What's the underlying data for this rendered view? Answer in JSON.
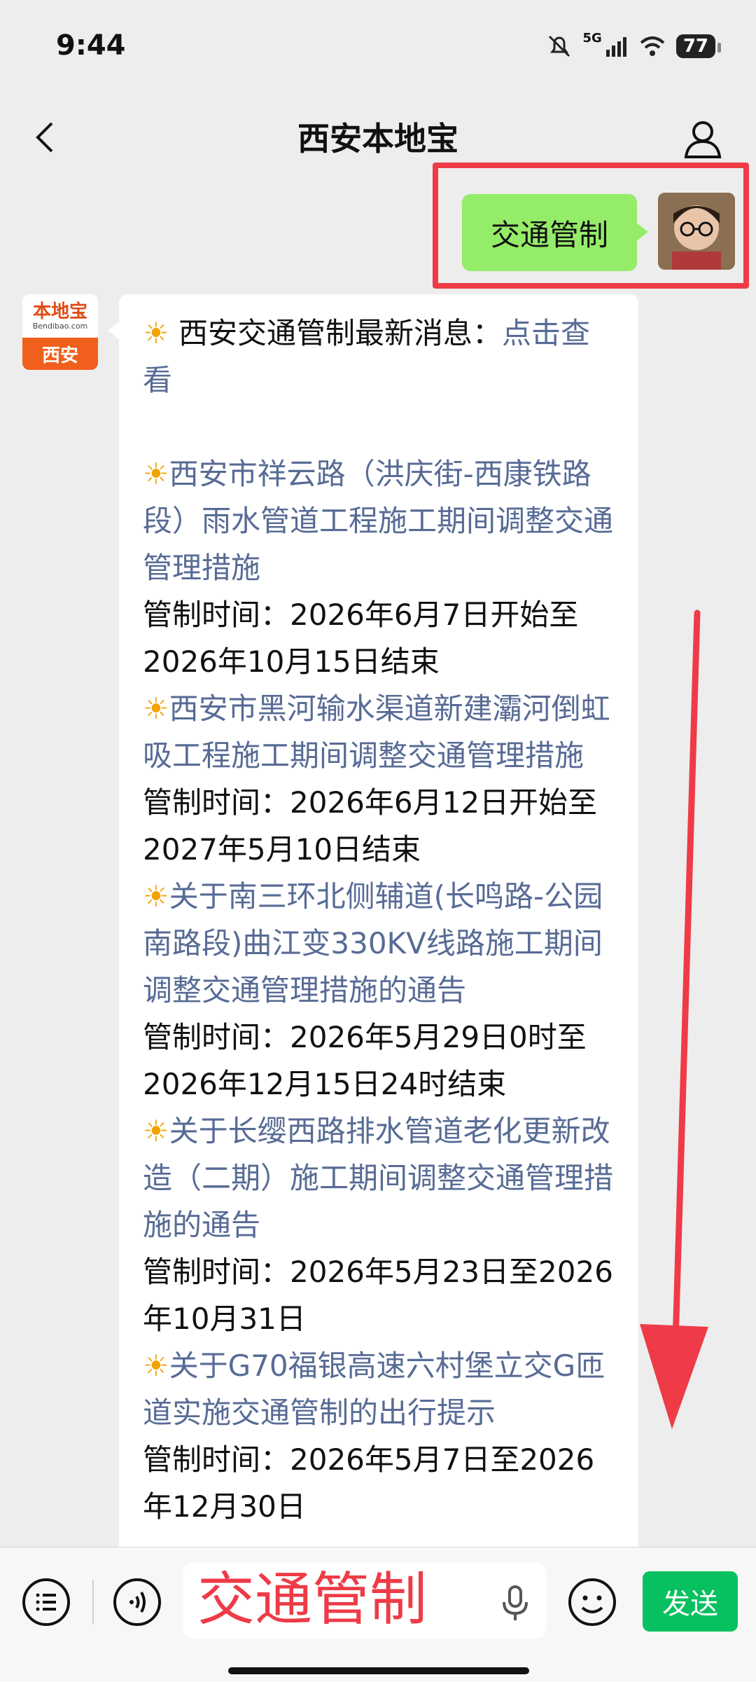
{
  "status": {
    "time": "9:44",
    "network": "5G",
    "battery": "77"
  },
  "nav": {
    "title": "西安本地宝"
  },
  "sent_message": {
    "text": "交通管制"
  },
  "bot": {
    "brand": "本地宝",
    "url": "Bendibao.com",
    "city": "西安"
  },
  "reply": {
    "intro_text": " 西安交通管制最新消息：",
    "intro_link": "点击查看",
    "items": [
      {
        "title": "西安市祥云路（洪庆街-西康铁路段）雨水管道工程施工期间调整交通管理措施",
        "time": "管制时间：2026年6月7日开始至2026年10月15日结束"
      },
      {
        "title": "西安市黑河输水渠道新建灞河倒虹吸工程施工期间调整交通管理措施",
        "time": "管制时间：2026年6月12日开始至2027年5月10日结束"
      },
      {
        "title": "关于南三环北侧辅道(长鸣路-公园南路段)曲江变330KV线路施工期间调整交通管理措施的通告",
        "time": "管制时间：2026年5月29日0时至2026年12月15日24时结束"
      },
      {
        "title": "关于长缨西路排水管道老化更新改造（二期）施工期间调整交通管理措施的通告",
        "time": "管制时间：2026年5月23日至2026年10月31日"
      },
      {
        "title": "关于G70福银高速六村堡立交G匝道实施交通管制的出行提示",
        "time": "管制时间：2026年5月7日至2026年12月30日"
      }
    ]
  },
  "input": {
    "value": "交通管制"
  },
  "send_button": {
    "label": "发送"
  },
  "colors": {
    "accent_green": "#07c160",
    "bubble_green": "#95ec69",
    "link": "#576b95",
    "highlight_red": "#ee3b47"
  }
}
